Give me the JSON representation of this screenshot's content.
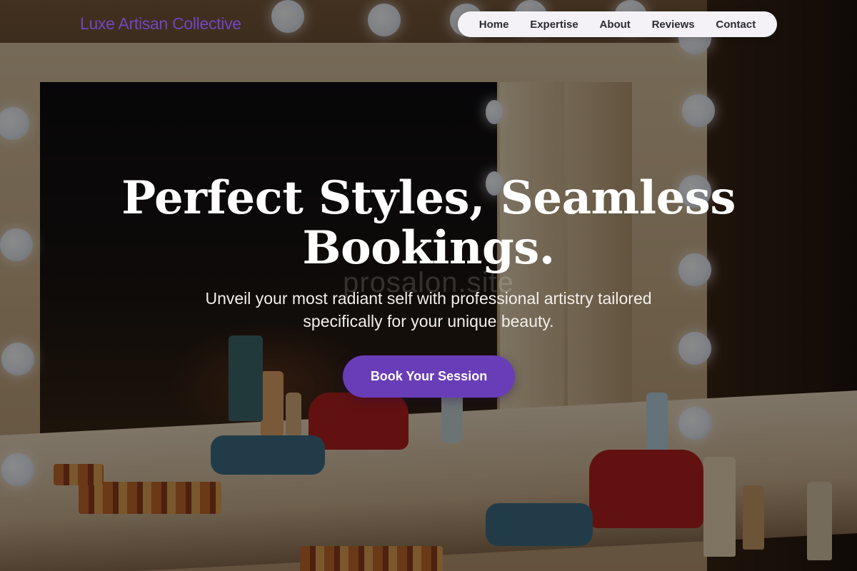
{
  "header": {
    "logo_text": "Luxe Artisan Collective",
    "nav": [
      {
        "label": "Home"
      },
      {
        "label": "Expertise"
      },
      {
        "label": "About"
      },
      {
        "label": "Reviews"
      },
      {
        "label": "Contact"
      }
    ]
  },
  "hero": {
    "title": "Perfect Styles, Seamless Bookings.",
    "subtitle": "Unveil your most radiant self with professional artistry tailored specifically for your unique beauty.",
    "cta_label": "Book Your Session",
    "background_watermark": "prosalon.site"
  },
  "colors": {
    "brand": "#7245c4",
    "button": "#6a3db8",
    "nav_bg": "#f4f2f6",
    "text_light": "#ffffff"
  }
}
